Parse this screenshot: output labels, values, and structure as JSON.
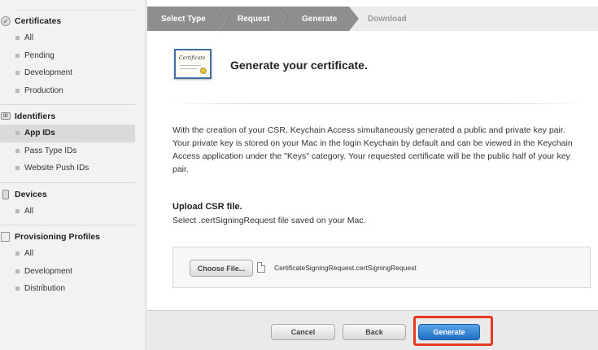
{
  "sidebar": {
    "sections": [
      {
        "title": "Certificates",
        "icon": "certificate-icon",
        "items": [
          "All",
          "Pending",
          "Development",
          "Production"
        ]
      },
      {
        "title": "Identifiers",
        "icon": "id-icon",
        "icon_text": "ID",
        "items": [
          "App IDs",
          "Pass Type IDs",
          "Website Push IDs"
        ],
        "active_item": "App IDs"
      },
      {
        "title": "Devices",
        "icon": "device-icon",
        "items": [
          "All"
        ]
      },
      {
        "title": "Provisioning Profiles",
        "icon": "profile-icon",
        "items": [
          "All",
          "Development",
          "Distribution"
        ]
      }
    ]
  },
  "steps": {
    "items": [
      "Select Type",
      "Request",
      "Generate",
      "Download"
    ],
    "current": "Generate",
    "done_color": "#8e8e8e"
  },
  "header": {
    "icon_text": "Certificate",
    "title": "Generate your certificate."
  },
  "description": "With the creation of your CSR, Keychain Access simultaneously generated a public and private key pair. Your private key is stored on your Mac in the login Keychain by default and can be viewed in the Keychain Access application under the \"Keys\" category. Your requested certificate will be the public half of your key pair.",
  "upload": {
    "title": "Upload CSR file.",
    "subtitle": "Select .certSigningRequest file saved on your Mac.",
    "choose_label": "Choose File...",
    "file_name": "CertificateSigningRequest.certSigningRequest"
  },
  "footer": {
    "cancel_label": "Cancel",
    "back_label": "Back",
    "generate_label": "Generate",
    "accent_color": "#1f6fc3",
    "highlight_color": "#e53a1f"
  }
}
